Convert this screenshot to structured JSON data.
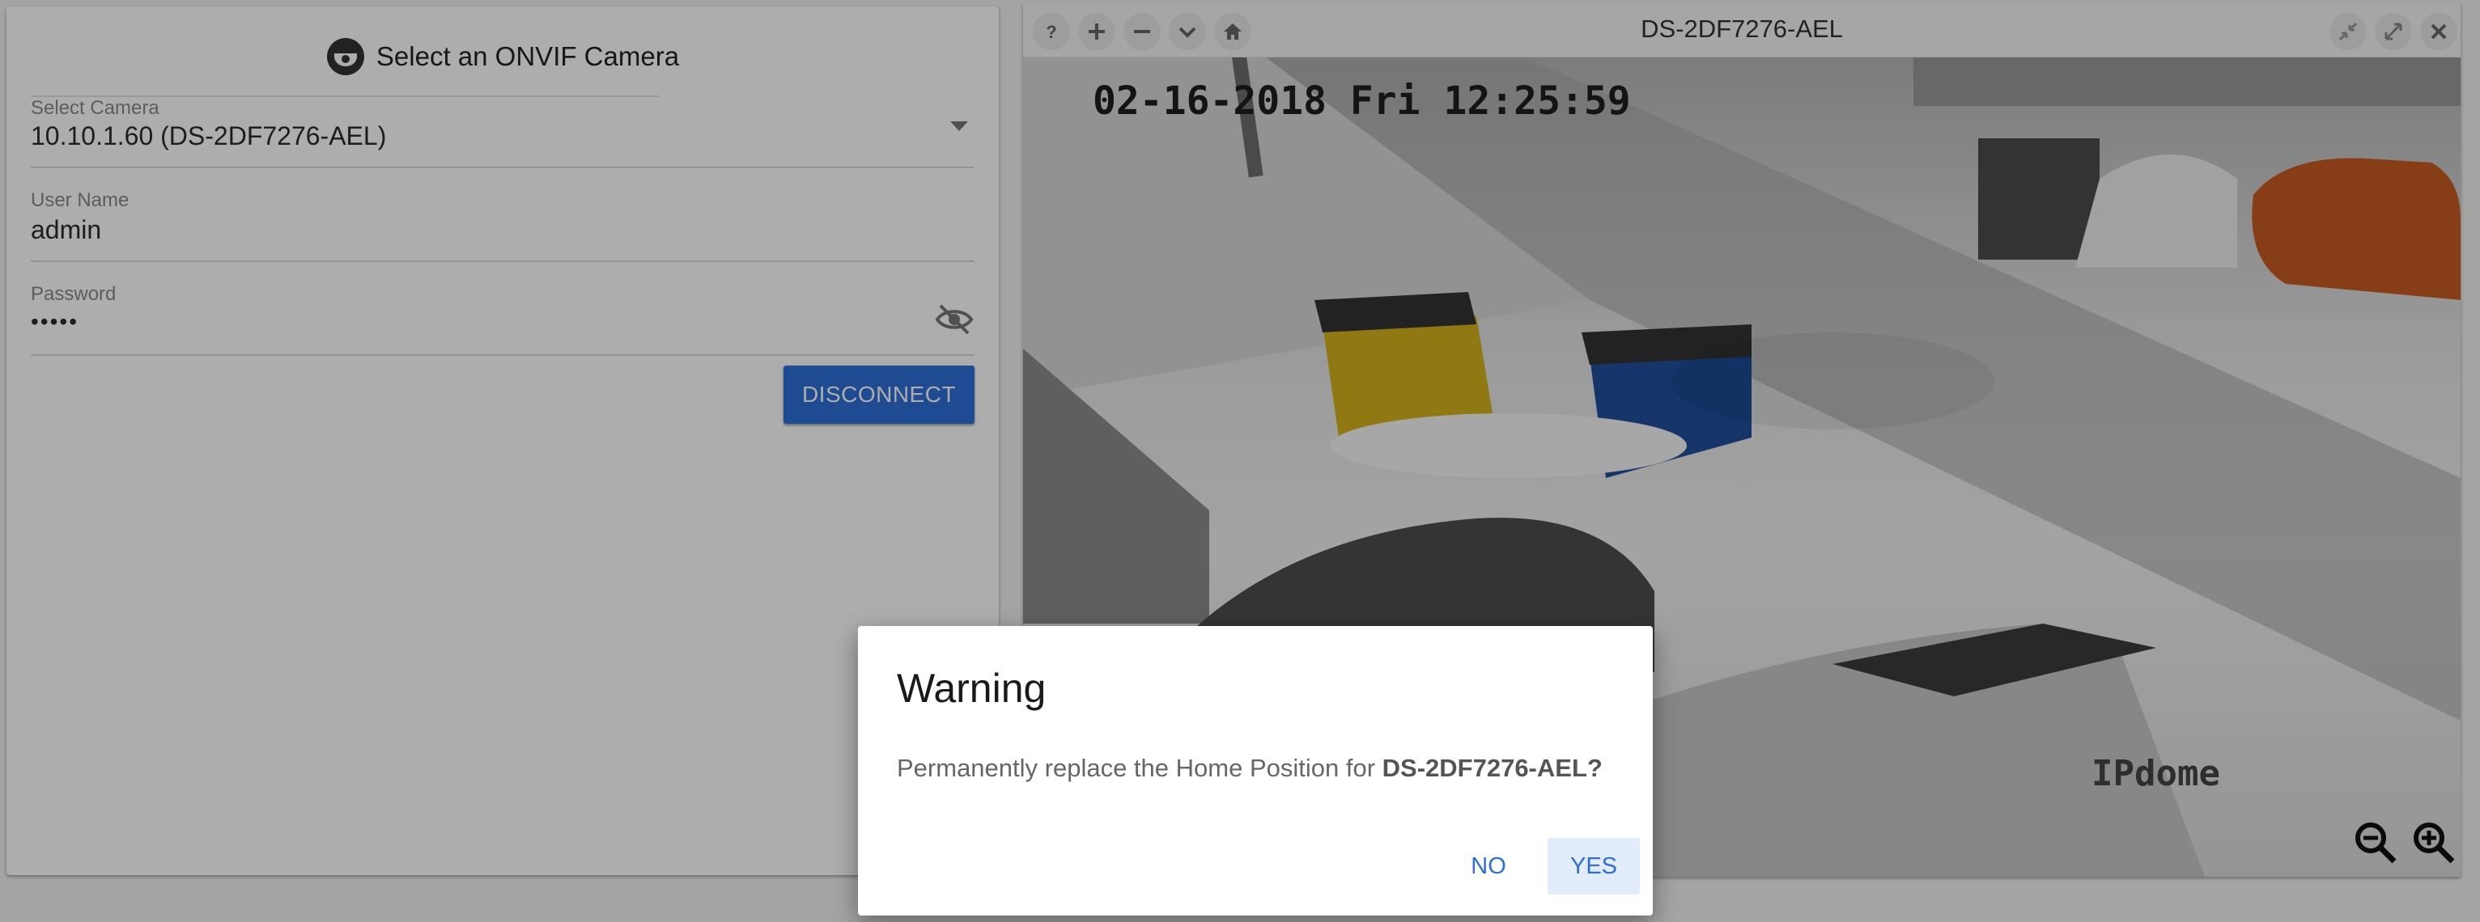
{
  "left_panel": {
    "title": "Select an ONVIF Camera",
    "camera_field": {
      "label": "Select Camera",
      "value": "10.10.1.60 (DS-2DF7276-AEL)"
    },
    "username_field": {
      "label": "User Name",
      "value": "admin"
    },
    "password_field": {
      "label": "Password",
      "value": "•••••"
    },
    "disconnect_label": "DISCONNECT"
  },
  "stream": {
    "title": "DS-2DF7276-AEL",
    "timestamp": "02-16-2018 Fri 12:25:59",
    "watermark": "IPdome"
  },
  "toolbar_icons": [
    "help-icon",
    "plus-icon",
    "minus-icon",
    "chevron-down-icon",
    "home-icon",
    "collapse-icon",
    "expand-icon",
    "close-icon"
  ],
  "dialog": {
    "title": "Warning",
    "message_prefix": "Permanently replace the Home Position for ",
    "message_target": "DS-2DF7276-AEL?",
    "no_label": "NO",
    "yes_label": "YES"
  },
  "colors": {
    "accent": "#2d6fd6",
    "overlay": "rgba(0,0,0,0.32)"
  }
}
